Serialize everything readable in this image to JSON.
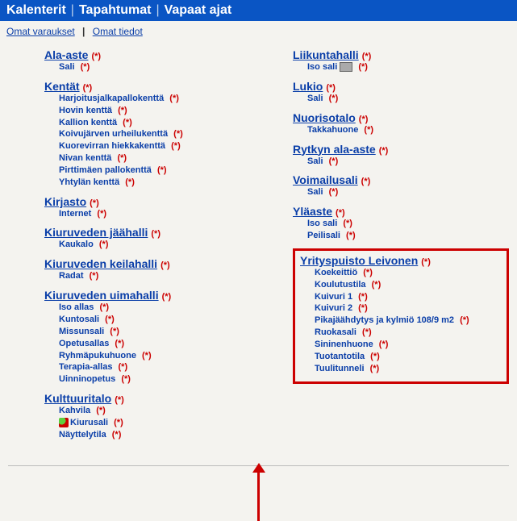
{
  "topnav": {
    "calendars": "Kalenterit",
    "events": "Tapahtumat",
    "freetimes": "Vapaat ajat"
  },
  "subnav": {
    "own_bookings": "Omat varaukset",
    "own_info": "Omat tiedot"
  },
  "marker": "(*)",
  "left": [
    {
      "title": "Ala-aste",
      "items": [
        "Sali"
      ]
    },
    {
      "title": "Kentät",
      "items": [
        "Harjoitusjalkapallokenttä",
        "Hovin kenttä",
        "Kallion kenttä",
        "Koivujärven urheilukenttä",
        "Kuorevirran hiekkakenttä",
        "Nivan kenttä",
        "Pirttimäen pallokenttä",
        "Yhtylän kenttä"
      ]
    },
    {
      "title": "Kirjasto",
      "items": [
        "Internet"
      ]
    },
    {
      "title": "Kiuruveden jäähalli",
      "items": [
        "Kaukalo"
      ]
    },
    {
      "title": "Kiuruveden keilahalli",
      "items": [
        "Radat"
      ]
    },
    {
      "title": "Kiuruveden uimahalli",
      "items": [
        "Iso allas",
        "Kuntosali",
        "Missunsali",
        "Opetusallas",
        "Ryhmäpukuhuone",
        "Terapia-allas",
        "Uinninopetus"
      ]
    },
    {
      "title": "Kulttuuritalo",
      "items": [
        "Kahvila",
        "Kiurusali",
        "Näyttelytila"
      ]
    }
  ],
  "right": [
    {
      "title": "Liikuntahalli",
      "items": [
        "Iso sali"
      ],
      "cam": true
    },
    {
      "title": "Lukio",
      "items": [
        "Sali"
      ]
    },
    {
      "title": "Nuorisotalo",
      "items": [
        "Takkahuone"
      ]
    },
    {
      "title": "Rytkyn ala-aste",
      "items": [
        "Sali"
      ]
    },
    {
      "title": "Voimailusali",
      "items": [
        "Sali"
      ]
    },
    {
      "title": "Yläaste",
      "items": [
        "Iso sali",
        "Peilisali"
      ]
    },
    {
      "title": "Yrityspuisto Leivonen",
      "highlight": true,
      "items": [
        "Koekeittiö",
        "Koulutustila",
        "Kuivuri 1",
        "Kuivuri 2",
        "Pikajäähdytys ja kylmiö 108/9 m2",
        "Ruokasali",
        "Sininenhuone",
        "Tuotantotila",
        "Tuulitunneli"
      ]
    }
  ]
}
